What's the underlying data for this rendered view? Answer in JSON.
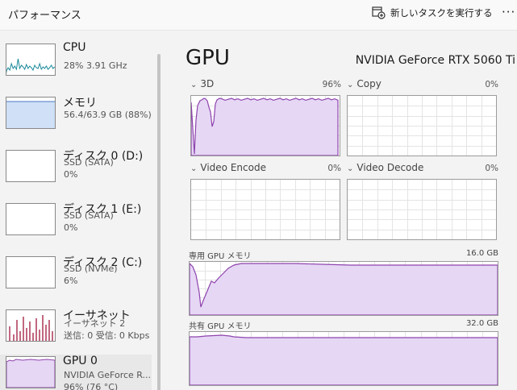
{
  "header": {
    "title": "パフォーマンス",
    "run_task_label": "新しいタスクを実行する",
    "more_label": "···"
  },
  "sidebar": {
    "items": [
      {
        "name": "CPU",
        "lines": [
          "28%  3.91 GHz"
        ]
      },
      {
        "name": "メモリ",
        "lines": [
          "56.4/63.9 GB (88%)"
        ]
      },
      {
        "name": "ディスク 0 (D:)",
        "lines": [
          "SSD (SATA)",
          "0%"
        ]
      },
      {
        "name": "ディスク 1 (E:)",
        "lines": [
          "SSD (SATA)",
          "0%"
        ]
      },
      {
        "name": "ディスク 2 (C:)",
        "lines": [
          "SSD (NVMe)",
          "6%"
        ]
      },
      {
        "name": "イーサネット",
        "lines": [
          "イーサネット 2",
          "送信: 0 受信: 0 Kbps"
        ]
      },
      {
        "name": "GPU 0",
        "lines": [
          "NVIDIA GeForce R...",
          "96%  (76 °C)"
        ]
      }
    ]
  },
  "main": {
    "title": "GPU",
    "model": "NVIDIA GeForce RTX 5060 Ti",
    "engines": [
      {
        "label": "3D",
        "percent": "96%",
        "chevron": "⌄"
      },
      {
        "label": "Copy",
        "percent": "0%",
        "chevron": "⌄"
      },
      {
        "label": "Video Encode",
        "percent": "0%",
        "chevron": "⌄"
      },
      {
        "label": "Video Decode",
        "percent": "0%",
        "chevron": "⌄"
      }
    ],
    "dedicated_memory": {
      "label": "専用 GPU メモリ",
      "max": "16.0 GB"
    },
    "shared_memory": {
      "label": "共有 GPU メモリ",
      "max": "32.0 GB"
    }
  },
  "colors": {
    "gpu_stroke": "#8e44ad",
    "gpu_fill": "#e6d7f5",
    "cpu_stroke": "#1b8a9b",
    "mem_stroke": "#4a79c4",
    "mem_fill": "#cfe0f7",
    "net_stroke": "#a0163b",
    "grid": "#e4e4e4",
    "selected_bg": "#e8e8e8"
  }
}
